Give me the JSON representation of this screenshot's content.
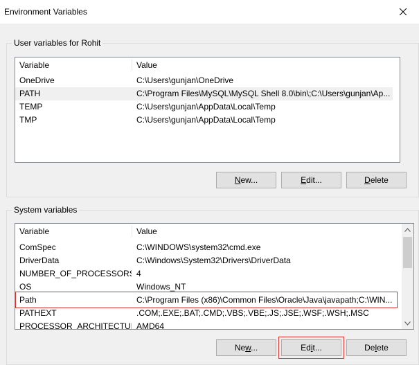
{
  "window": {
    "title": "Environment Variables",
    "close_icon": "close-icon"
  },
  "user_vars": {
    "group_label": "User variables for Rohit",
    "columns": [
      "Variable",
      "Value"
    ],
    "rows": [
      {
        "variable": "OneDrive",
        "value": "C:\\Users\\gunjan\\OneDrive"
      },
      {
        "variable": "PATH",
        "value": "C:\\Program Files\\MySQL\\MySQL Shell 8.0\\bin\\;C:\\Users\\gunjan\\Ap..."
      },
      {
        "variable": "TEMP",
        "value": "C:\\Users\\gunjan\\AppData\\Local\\Temp"
      },
      {
        "variable": "TMP",
        "value": "C:\\Users\\gunjan\\AppData\\Local\\Temp"
      }
    ],
    "buttons": {
      "new_prefix": "",
      "new_u": "N",
      "new_rest": "ew...",
      "edit_prefix": "",
      "edit_u": "E",
      "edit_rest": "dit...",
      "delete_prefix": "",
      "delete_u": "D",
      "delete_rest": "elete"
    }
  },
  "system_vars": {
    "group_label": "System variables",
    "columns": [
      "Variable",
      "Value"
    ],
    "rows": [
      {
        "variable": "ComSpec",
        "value": "C:\\WINDOWS\\system32\\cmd.exe"
      },
      {
        "variable": "DriverData",
        "value": "C:\\Windows\\System32\\Drivers\\DriverData"
      },
      {
        "variable": "NUMBER_OF_PROCESSORS",
        "value": "4"
      },
      {
        "variable": "OS",
        "value": "Windows_NT"
      },
      {
        "variable": "Path",
        "value": "C:\\Program Files (x86)\\Common Files\\Oracle\\Java\\javapath;C:\\WIN..."
      },
      {
        "variable": "PATHEXT",
        "value": ".COM;.EXE;.BAT;.CMD;.VBS;.VBE;.JS;.JSE;.WSF;.WSH;.MSC"
      },
      {
        "variable": "PROCESSOR_ARCHITECTURE",
        "value": "AMD64"
      }
    ],
    "buttons": {
      "new_prefix": "Ne",
      "new_u": "w",
      "new_rest": "...",
      "edit_prefix": "Ed",
      "edit_u": "i",
      "edit_rest": "t...",
      "delete_prefix": "De",
      "delete_u": "l",
      "delete_rest": "ete"
    }
  },
  "colors": {
    "highlight_box": "#d9302e",
    "dialog_bg": "#f0f0f0"
  }
}
